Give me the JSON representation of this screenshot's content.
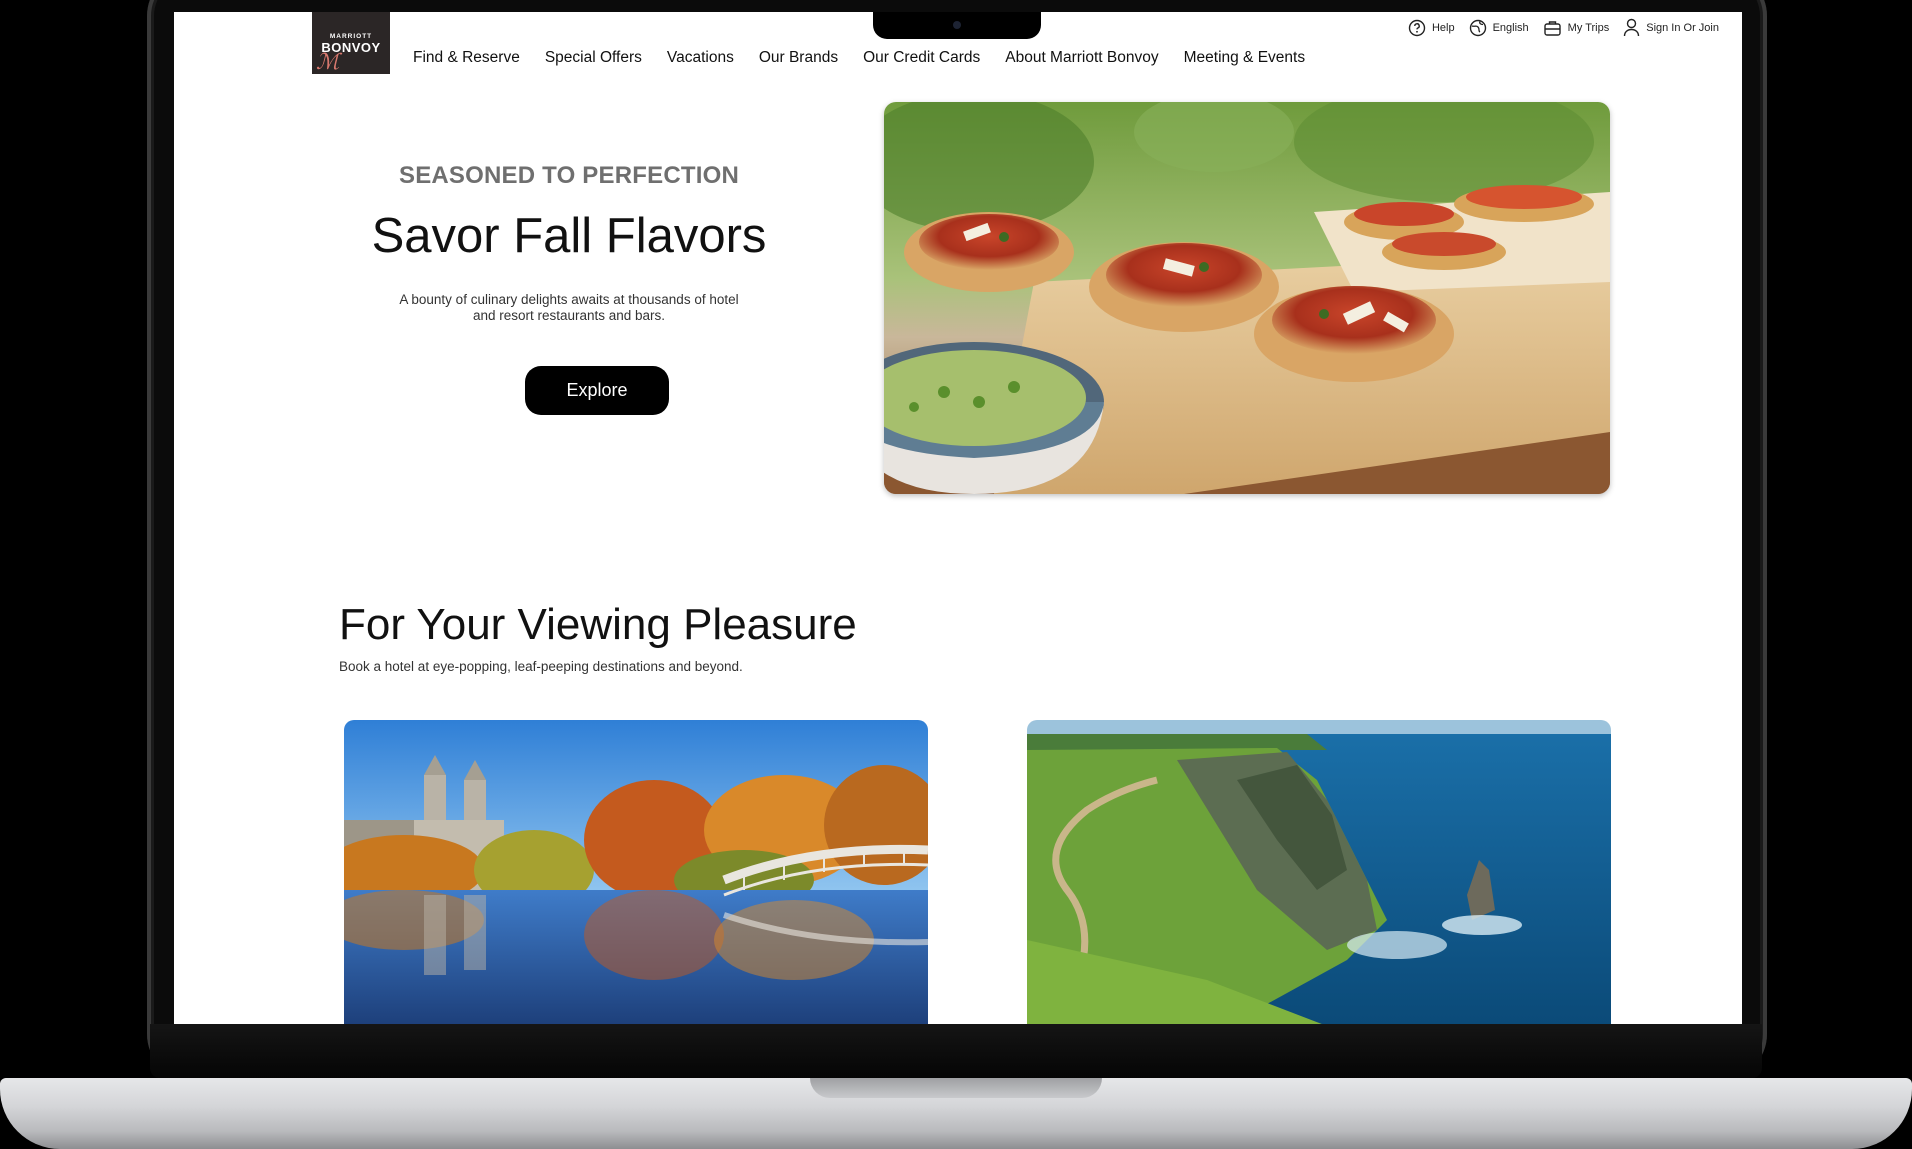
{
  "brand": {
    "logo_small": "MARRIOTT",
    "logo_big": "BONVOY"
  },
  "nav": {
    "items": [
      "Find & Reserve",
      "Special Offers",
      "Vacations",
      "Our Brands",
      "Our Credit Cards",
      "About Marriott Bonvoy",
      "Meeting & Events"
    ]
  },
  "utility": {
    "help": "Help",
    "language": "English",
    "trips": "My Trips",
    "signin": "Sign In Or Join"
  },
  "hero": {
    "eyebrow": "SEASONED TO PERFECTION",
    "title": "Savor Fall Flavors",
    "description": "A bounty of culinary delights awaits at thousands of hotel and resort restaurants and bars.",
    "cta": "Explore"
  },
  "section": {
    "title": "For Your Viewing Pleasure",
    "description": "Book a hotel at eye-popping, leaf-peeping destinations and beyond."
  },
  "icons": [
    "help-icon",
    "globe-icon",
    "briefcase-icon",
    "user-icon"
  ],
  "colors": {
    "primary": "#000000",
    "logo_bg": "#2b2626",
    "text": "#111111"
  }
}
